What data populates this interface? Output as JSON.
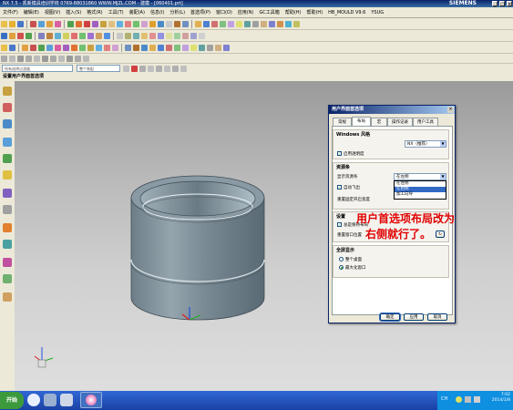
{
  "window": {
    "title": "NX 7.5 - 凯新模具培训学校  0769-88031860  WWW.MJZL.COM - 建模 - [060401.prt]",
    "brand": "SIEMENS",
    "controls": [
      "_",
      "□",
      "×"
    ]
  },
  "menubar": {
    "items": [
      "文件(F)",
      "编辑(E)",
      "视图(V)",
      "插入(S)",
      "格式(R)",
      "工具(T)",
      "装配(A)",
      "信息(I)",
      "分析(L)",
      "首选项(P)",
      "窗口(O)",
      "应用(N)",
      "GC工具箱",
      "帮助(H)",
      "帮助(H)",
      "HB_MOULD V9.6",
      "YSUG"
    ]
  },
  "toolbar": {
    "filter_dropdown": "所有选择过滤器",
    "assembly_dropdown": "整个装配"
  },
  "graphics_window": {
    "header": "设置用户界面首选项"
  },
  "dialog": {
    "title": "用户界面首选项",
    "close": "×",
    "tabs": [
      "常规",
      "布局",
      "宏",
      "操作记录",
      "用户工具"
    ],
    "windows_group": {
      "title": "Windows 风格",
      "style_value": "NX（推荐）",
      "transparency_label": "启用透明度",
      "transparency_checked": true
    },
    "resource_group": {
      "title": "资源条",
      "display_label": "显示资源条",
      "display_value": "在左侧",
      "options": [
        "在左侧",
        "在右侧",
        "加工向导"
      ],
      "highlighted_option": "在右侧",
      "autofly_label": "自动飞出",
      "autofly_checked": true,
      "reset_label": "重置固定开启宽度"
    },
    "settings_group": {
      "title": "设置",
      "remember_label": "总是保持布局",
      "remember_checked": true,
      "reset_label": "重置窗口位置"
    },
    "fullscreen_group": {
      "title": "全屏显示",
      "option_whole": "整个桌面",
      "option_max": "最大化窗口",
      "selected": "最大化窗口"
    },
    "buttons": {
      "ok": "确定",
      "apply": "应用",
      "cancel": "取消"
    }
  },
  "annotation": {
    "line1": "用户首选项布局改为",
    "line2": "右侧就行了。"
  },
  "taskbar": {
    "start": "开始",
    "input_indicator": "CH",
    "time": "7:02",
    "date": "2014/1/8"
  },
  "colors": {
    "annotation": "#e00000",
    "title_bar": "#0a246a",
    "taskbar": "#1941a5",
    "part_body": "#7a8a94"
  }
}
